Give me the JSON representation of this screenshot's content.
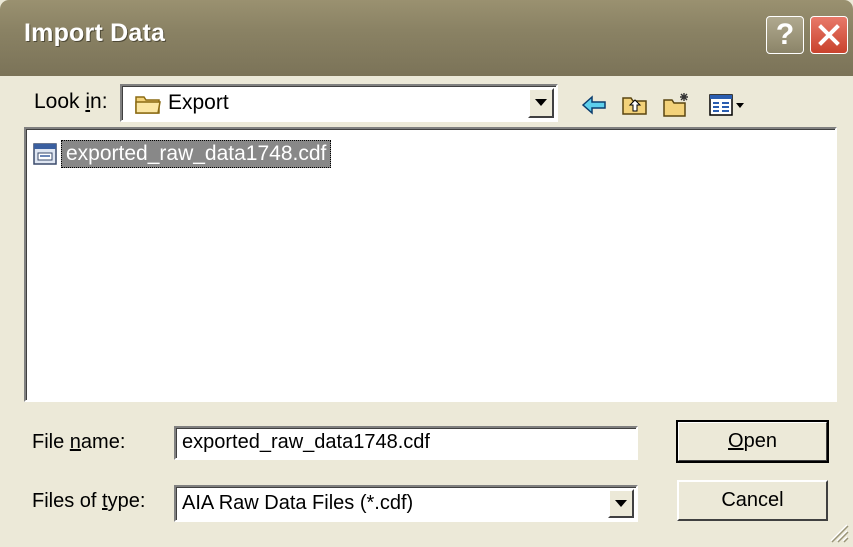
{
  "window": {
    "title": "Import Data",
    "help_label": "?"
  },
  "look_in": {
    "label_pre": "Look ",
    "label_u": "i",
    "label_post": "n:",
    "value": "Export",
    "folder_icon": "folder-icon"
  },
  "toolbar": {
    "icons": [
      "back-arrow-icon",
      "up-folder-icon",
      "new-folder-icon",
      "view-menu-icon"
    ]
  },
  "files": [
    {
      "name": "exported_raw_data1748.cdf",
      "icon": "data-file-icon",
      "selected": true
    }
  ],
  "file_name": {
    "label_pre": "File ",
    "label_u": "n",
    "label_post": "ame:",
    "value": "exported_raw_data1748.cdf"
  },
  "file_type": {
    "label_pre": "Files of ",
    "label_u": "t",
    "label_post": "ype:",
    "value": "AIA Raw Data Files (*.cdf)"
  },
  "buttons": {
    "open_u": "O",
    "open_rest": "pen",
    "cancel": "Cancel"
  }
}
